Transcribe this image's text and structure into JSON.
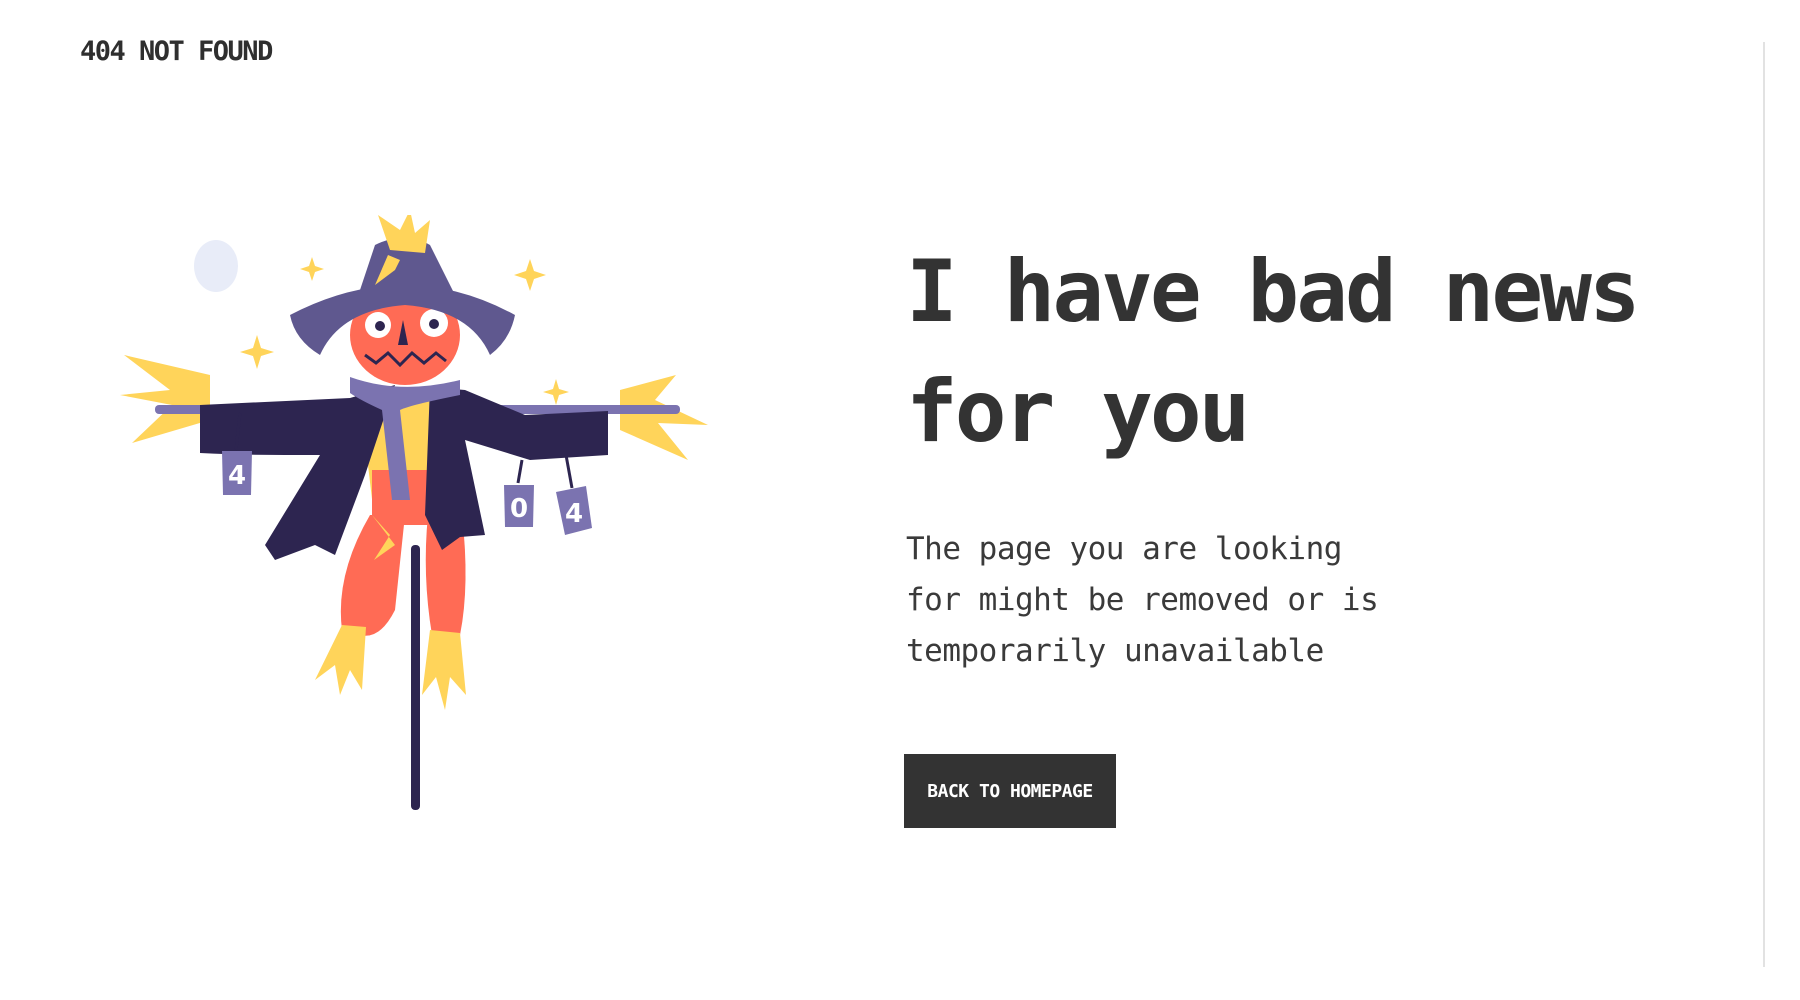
{
  "header": {
    "brand": "404 NOT FOUND"
  },
  "illustration": {
    "can_labels": [
      "4",
      "0",
      "4"
    ]
  },
  "main": {
    "headline_line1": "I have bad news",
    "headline_line2": "for you",
    "message_line1": "The page you are looking",
    "message_line2": "for might be removed or is",
    "message_line3": "temporarily unavailable",
    "button_label": "BACK TO HOMEPAGE"
  },
  "colors": {
    "text": "#333333",
    "button_bg": "#333333",
    "button_text": "#ffffff",
    "hat": "#5f588f",
    "coat": "#2d2550",
    "pumpkin": "#ff6b55",
    "straw": "#ffd45a",
    "scarf": "#7b73b0"
  }
}
